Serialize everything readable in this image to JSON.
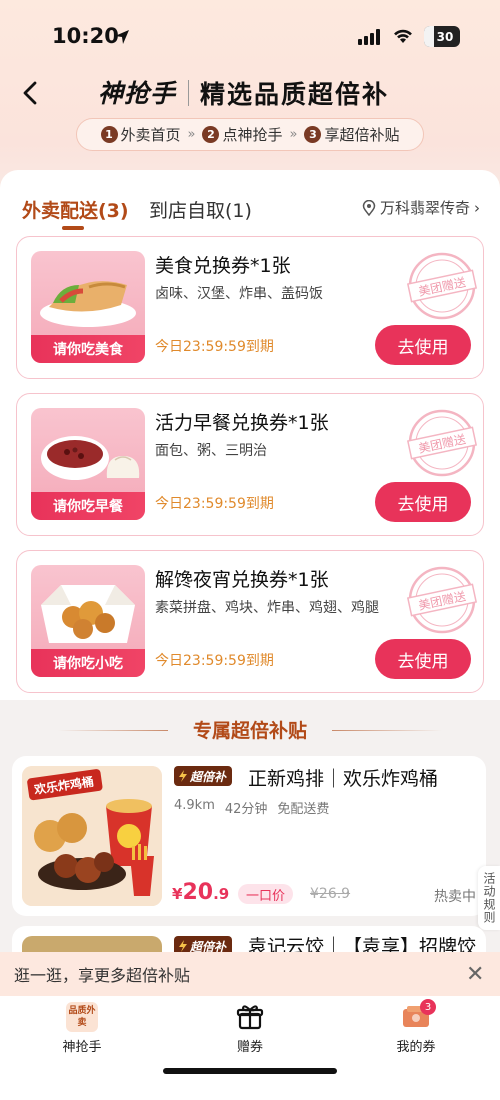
{
  "status_bar": {
    "time": "10:20",
    "battery": "30"
  },
  "header": {
    "brand": "神抢手",
    "title": "精选品质超倍补",
    "steps": [
      {
        "num": "1",
        "label": "外卖首页"
      },
      {
        "num": "2",
        "label": "点神抢手"
      },
      {
        "num": "3",
        "label": "享超倍补贴"
      }
    ]
  },
  "tabs": {
    "active": "外卖配送(3)",
    "other": "到店自取(1)",
    "location": "万科翡翠传奇"
  },
  "coupons": [
    {
      "name": "美食兑换券*1张",
      "desc": "卤味、汉堡、炸串、盖码饭",
      "expire": "今日23:59:59到期",
      "thumb_label": "请你吃美食",
      "button": "去使用",
      "stamp": "美团赠送"
    },
    {
      "name": "活力早餐兑换券*1张",
      "desc": "面包、粥、三明治",
      "expire": "今日23:59:59到期",
      "thumb_label": "请你吃早餐",
      "button": "去使用",
      "stamp": "美团赠送"
    },
    {
      "name": "解馋夜宵兑换券*1张",
      "desc": "素菜拼盘、鸡块、炸串、鸡翅、鸡腿",
      "expire": "今日23:59:59到期",
      "thumb_label": "请你吃小吃",
      "button": "去使用",
      "stamp": "美团赠送"
    }
  ],
  "section": {
    "title": "专属超倍补贴"
  },
  "stores": [
    {
      "badge": "超倍补",
      "name": "正新鸡排｜欢乐炸鸡桶",
      "img_text": "欢乐炸鸡桶",
      "distance": "4.9km",
      "time": "42分钟",
      "delivery": "免配送费",
      "price_symbol": "¥",
      "price_int": "20",
      "price_dec": ".9",
      "price_tag": "一口价",
      "orig_price": "¥26.9",
      "status": "热卖中"
    },
    {
      "badge": "超倍补",
      "name": "袁记云饺｜【袁享】招牌饺"
    }
  ],
  "side_tab": {
    "label": "活动规则"
  },
  "promo": {
    "text": "逛一逛，享更多超倍补贴",
    "close": "✕"
  },
  "bottom_nav": {
    "items": [
      {
        "label": "神抢手",
        "icon_text": "品质外卖"
      },
      {
        "label": "赠券"
      },
      {
        "label": "我的券",
        "badge": "3"
      }
    ]
  },
  "colors": {
    "accent": "#e8335a",
    "brand_brown": "#b24a18",
    "expire": "#e08a2c"
  }
}
